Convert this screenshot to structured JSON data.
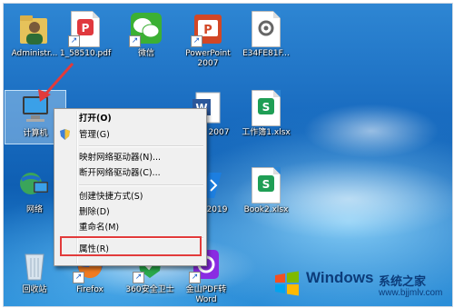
{
  "desktop": {
    "icons": [
      {
        "label": "Administr..."
      },
      {
        "label": "1_58510.pdf"
      },
      {
        "label": "微信"
      },
      {
        "label": "PowerPoint 2007"
      },
      {
        "label": "E34FE81F..."
      },
      {
        "label": "计算机"
      },
      {
        "label": "2007"
      },
      {
        "label": "工作簿1.xlsx"
      },
      {
        "label": "网络"
      },
      {
        "label": "2019"
      },
      {
        "label": "Book2.xlsx"
      },
      {
        "label": "回收站"
      },
      {
        "label": "Firefox"
      },
      {
        "label": "360安全卫士"
      },
      {
        "label": "金山PDF转 Word"
      }
    ]
  },
  "context_menu": {
    "items": [
      {
        "label": "打开(O)"
      },
      {
        "label": "管理(G)"
      },
      {
        "label": "映射网络驱动器(N)..."
      },
      {
        "label": "断开网络驱动器(C)..."
      },
      {
        "label": "创建快捷方式(S)"
      },
      {
        "label": "删除(D)"
      },
      {
        "label": "重命名(M)"
      },
      {
        "label": "属性(R)"
      }
    ]
  },
  "watermark": {
    "title": "Windows",
    "subtitle": "系统之家",
    "url": "www.bjjmlv.com"
  }
}
